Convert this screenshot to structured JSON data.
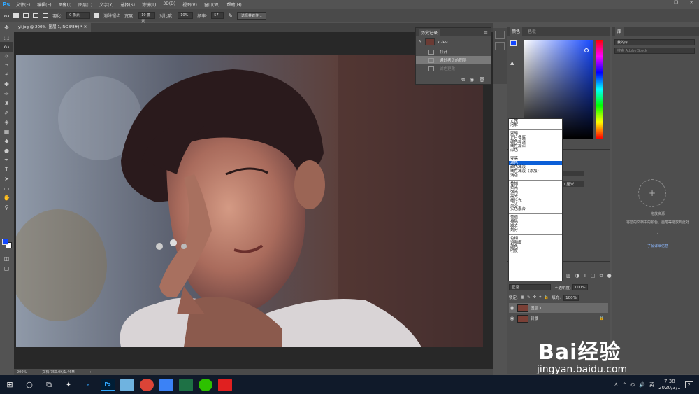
{
  "app": {
    "logo": "Ps"
  },
  "menu": [
    "文件(F)",
    "编辑(E)",
    "图像(I)",
    "图层(L)",
    "文字(Y)",
    "选择(S)",
    "滤镜(T)",
    "3D(D)",
    "视图(V)",
    "窗口(W)",
    "帮助(H)"
  ],
  "options": {
    "feather_label": "羽化:",
    "feather_value": "0 像素",
    "antialias_label": "消除锯齿",
    "width_label": "宽度:",
    "width_value": "10 像素",
    "contrast_label": "对比度:",
    "contrast_value": "10%",
    "frequency_label": "频率:",
    "frequency_value": "57",
    "select_mask_label": "选择并遮住..."
  },
  "document": {
    "tab_title": "yi.jpg @ 200% (图层 1, RGB/8#) *",
    "zoom": "200%",
    "doc_info": "文档:750.0K/1.46M"
  },
  "history": {
    "title": "历史记录",
    "snapshot": "yi.jpg",
    "items": [
      {
        "label": "打开",
        "selected": false
      },
      {
        "label": "通过拷贝的图层",
        "selected": true
      },
      {
        "label": "滤色更改",
        "selected": false
      }
    ]
  },
  "color_panel": {
    "tabs": [
      "颜色",
      "色板"
    ],
    "foreground": "#1447ff"
  },
  "blend_modes": {
    "groups": [
      [
        "正常",
        "溶解"
      ],
      [
        "变暗",
        "正片叠底",
        "颜色加深",
        "线性加深",
        "深色"
      ],
      [
        "变亮",
        "滤色",
        "颜色减淡",
        "线性减淡（添加）",
        "浅色"
      ],
      [
        "叠加",
        "柔光",
        "强光",
        "亮光",
        "线性光",
        "点光",
        "实色混合"
      ],
      [
        "差值",
        "排除",
        "减去",
        "划分"
      ],
      [
        "色相",
        "饱和度",
        "颜色",
        "明度"
      ]
    ],
    "selected": "滤色"
  },
  "properties": {
    "value": "0 厘米"
  },
  "layers": {
    "blend_mode": "正常",
    "opacity_label": "不透明度:",
    "opacity_value": "100%",
    "lock_label": "锁定:",
    "fill_label": "填充:",
    "fill_value": "100%",
    "items": [
      {
        "name": "图层 1",
        "selected": true
      },
      {
        "name": "背景",
        "selected": false
      }
    ]
  },
  "library": {
    "title": "库",
    "select": "我的库",
    "search_placeholder": "搜索 Adobe Stock",
    "empty_title": "拖放资源",
    "empty_desc": "将您的文档中的颜色、画笔等拖放到此处",
    "help_link": "了解详细信息"
  },
  "taskbar": {
    "time": "7:38",
    "date": "2020/3/1",
    "notif_count": "2"
  },
  "watermark": {
    "main": "Bai经验",
    "sub": "jingyan.baidu.com"
  }
}
